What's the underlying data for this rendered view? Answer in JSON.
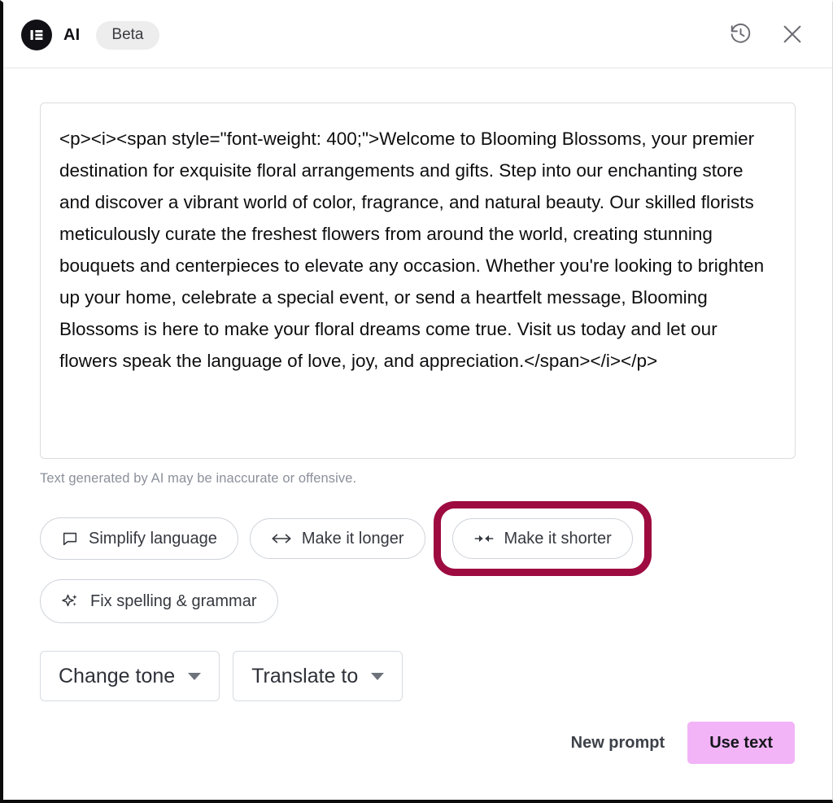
{
  "header": {
    "brand_name": "AI",
    "badge": "Beta",
    "logo_icon": "elementor-logo-icon",
    "history_icon": "history-clock-icon",
    "close_icon": "close-icon"
  },
  "result": {
    "text": "<p><i><span style=\"font-weight: 400;\">Welcome to Blooming Blossoms, your premier destination for exquisite floral arrangements and gifts. Step into our enchanting store and discover a vibrant world of color, fragrance, and natural beauty. Our skilled florists meticulously curate the freshest flowers from around the world, creating stunning bouquets and centerpieces to elevate any occasion. Whether you're looking to brighten up your home, celebrate a special event, or send a heartfelt message, Blooming Blossoms is here to make your floral dreams come true. Visit us today and let our flowers speak the language of love, joy, and appreciation.</span></i></p>",
    "disclaimer": "Text generated by AI may be inaccurate or offensive."
  },
  "actions": {
    "chips": [
      {
        "label": "Simplify language",
        "icon": "speech-bubble-icon",
        "highlighted": false
      },
      {
        "label": "Make it longer",
        "icon": "arrows-expand-icon",
        "highlighted": false
      },
      {
        "label": "Make it shorter",
        "icon": "arrows-collapse-icon",
        "highlighted": true
      },
      {
        "label": "Fix spelling & grammar",
        "icon": "sparkle-icon",
        "highlighted": false
      }
    ],
    "highlight_color": "#9d0b40"
  },
  "dropdowns": [
    {
      "label": "Change tone",
      "icon": "chevron-down-icon"
    },
    {
      "label": "Translate to",
      "icon": "chevron-down-icon"
    }
  ],
  "footer": {
    "new_prompt_label": "New prompt",
    "use_text_label": "Use text",
    "use_text_color": "#f2b4f7"
  }
}
